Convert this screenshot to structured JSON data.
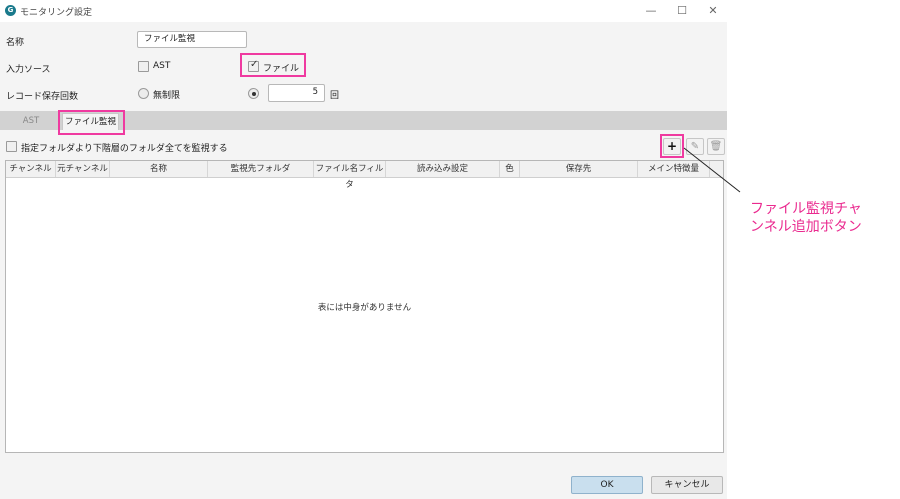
{
  "window": {
    "title": "モニタリング設定",
    "icon": "app-logo-icon",
    "controls": {
      "minimize": "—",
      "maximize": "☐",
      "close": "✕"
    }
  },
  "form": {
    "name_label": "名称",
    "name_value": "ファイル監視",
    "input_source_label": "入力ソース",
    "source_ast_label": "AST",
    "source_ast_checked": false,
    "source_file_label": "ファイル",
    "source_file_checked": true,
    "record_label": "レコード保存回数",
    "unlimited_label": "無制限",
    "unlimited_selected": false,
    "count_selected": true,
    "count_value": "5",
    "count_unit": "回"
  },
  "tabs": [
    {
      "label": "AST",
      "active": false
    },
    {
      "label": "ファイル監視",
      "active": true
    }
  ],
  "panel": {
    "subfolder_checkbox_label": "指定フォルダより下階層のフォルダ全てを監視する",
    "subfolder_checked": false,
    "toolbar": {
      "add": "+",
      "edit": "✎",
      "delete": "🗑"
    }
  },
  "table": {
    "columns": [
      "チャンネル",
      "元チャンネル",
      "名称",
      "監視先フォルダ",
      "ファイル名フィルタ",
      "読み込み設定",
      "色",
      "保存先",
      "メイン特徴量"
    ],
    "rows": [],
    "empty_message": "表には中身がありません"
  },
  "footer": {
    "ok": "OK",
    "cancel": "キャンセル"
  },
  "annotation": {
    "line1": "ファイル監視チャ",
    "line2": "ンネル追加ボタン",
    "color": "#ea2a8f"
  },
  "colors": {
    "highlight": "#ef3aa0",
    "ok_button": "#c9dfee"
  }
}
